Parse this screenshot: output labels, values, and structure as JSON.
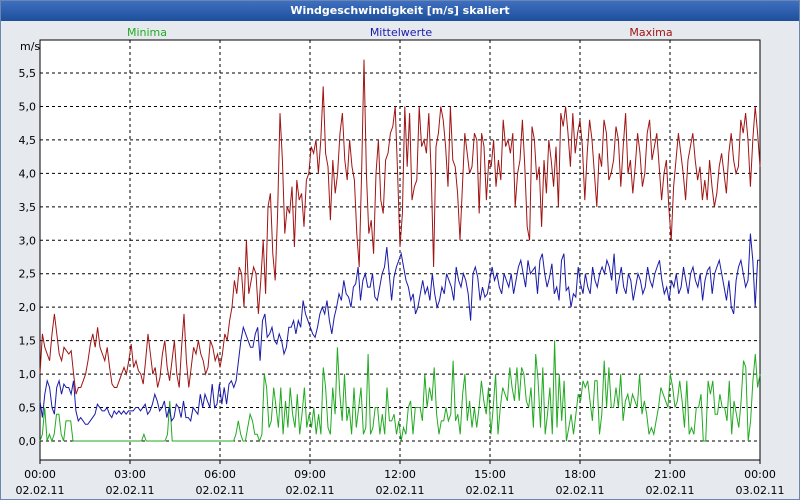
{
  "window": {
    "title": "Windgeschwindigkeit [m/s] skaliert"
  },
  "chart_data": {
    "type": "line",
    "title": "Windgeschwindigkeit [m/s] skaliert",
    "ylabel": "m/s",
    "ylim": [
      0,
      6
    ],
    "yticks": [
      "0,0",
      "0,5",
      "1,0",
      "1,5",
      "2,0",
      "2,5",
      "3,0",
      "3,5",
      "4,0",
      "4,5",
      "5,0",
      "5,5"
    ],
    "xlim": [
      "02.02.11 00:00",
      "03.02.11 00:00"
    ],
    "xticks": [
      {
        "time": "00:00",
        "date": "02.02.11"
      },
      {
        "time": "03:00",
        "date": "02.02.11"
      },
      {
        "time": "06:00",
        "date": "02.02.11"
      },
      {
        "time": "09:00",
        "date": "02.02.11"
      },
      {
        "time": "12:00",
        "date": "02.02.11"
      },
      {
        "time": "15:00",
        "date": "02.02.11"
      },
      {
        "time": "18:00",
        "date": "02.02.11"
      },
      {
        "time": "21:00",
        "date": "02.02.11"
      },
      {
        "time": "00:00",
        "date": "03.02.11"
      }
    ],
    "grid": true,
    "legend_placement": "top",
    "sample_interval_minutes": 10,
    "series": [
      {
        "name": "Minima",
        "color": "#22aa22",
        "values": [
          0,
          0.1,
          0.5,
          0,
          0.1,
          0,
          0.1,
          0.4,
          0.4,
          0.1,
          0,
          0.3,
          0.3,
          0.3,
          0,
          0,
          0,
          0,
          0,
          0,
          0,
          0,
          0,
          0,
          0,
          0,
          0,
          0,
          0,
          0,
          0,
          0,
          0,
          0,
          0,
          0,
          0,
          0,
          0,
          0,
          0,
          0,
          0,
          0,
          0.1,
          0,
          0,
          0,
          0,
          0,
          0,
          0,
          0,
          0,
          0.1,
          0.6,
          0,
          0,
          0,
          0,
          0,
          0,
          0,
          0,
          0,
          0,
          0,
          0,
          0,
          0,
          0,
          0,
          0,
          0,
          0,
          0,
          0,
          0,
          0,
          0,
          0,
          0,
          0,
          0.1,
          0.3,
          0.1,
          0,
          0,
          0.2,
          0.4,
          0.3,
          0.1,
          0.1,
          0,
          0.1,
          1,
          0.8,
          0.2,
          0.3,
          0.8,
          0.5,
          0.2,
          0.8,
          0.1,
          0.6,
          0.2,
          0.8,
          0.4,
          0.2,
          0.7,
          0.1,
          0.4,
          0.8,
          0.2,
          0.4,
          0.2,
          0.5,
          0.1,
          0.4,
          0.1,
          1.1,
          0.8,
          0.2,
          0.1,
          0.8,
          0.4,
          1.4,
          0.7,
          0.3,
          1,
          0.3,
          0.5,
          0.1,
          0.8,
          0.2,
          0.5,
          0.8,
          0.1,
          0.2,
          1.3,
          0.1,
          0.2,
          0.5,
          0.5,
          0.1,
          0.4,
          0.1,
          0.8,
          0.3,
          0.3,
          0.4,
          0.1,
          0.3,
          0,
          0.2,
          0.1,
          0.5,
          0.6,
          0.1,
          0.5,
          0.5,
          0.5,
          0.3,
          1,
          0.5,
          0.8,
          0.6,
          1.1,
          0.4,
          0.1,
          0.3,
          0.3,
          0.5,
          0.3,
          0.4,
          1.2,
          0.3,
          0.4,
          0.1,
          0.7,
          1,
          0.3,
          0.6,
          0.2,
          0.5,
          0.2,
          0.5,
          0.9,
          0.6,
          0.4,
          0.8,
          0.1,
          0.5,
          1,
          0.1,
          0.5,
          0.8,
          0.7,
          0.6,
          1.1,
          0.8,
          0.6,
          1.1,
          0.6,
          1.1,
          1,
          0.6,
          0.5,
          0.8,
          0.2,
          1.3,
          0.9,
          0.2,
          1.1,
          0.1,
          0.4,
          0.8,
          0.1,
          1.5,
          0.2,
          1,
          0.3,
          0.9,
          0,
          0.2,
          0.4,
          0.1,
          0.4,
          0.7,
          0.6,
          0.9,
          0.8,
          0.9,
          0.6,
          0.3,
          0.9,
          0.9,
          0.1,
          0.4,
          1.2,
          0.5,
          1.1,
          0.5,
          0.5,
          0.8,
          0.5,
          1,
          0.3,
          0.6,
          0.7,
          0.5,
          0.7,
          0.6,
          0.5,
          1,
          0.4,
          0.6,
          0.4,
          0.1,
          0.2,
          0.1,
          0.3,
          0.5,
          0.8,
          0.7,
          0.6,
          0.5,
          1,
          0.8,
          0.5,
          0.6,
          0.9,
          0.6,
          0.2,
          0.9,
          0.1,
          0.2,
          0.1,
          0.5,
          0.5,
          0.7,
          0,
          0,
          0.9,
          0.7,
          0.9,
          0.4,
          0.4,
          0.7,
          0.5,
          0.5,
          0.3,
          0.9,
          0.1,
          0.6,
          0.4,
          0.2,
          0.6,
          1.2,
          1.1,
          0,
          0.3,
          0.9,
          1.3,
          0.8,
          1
        ]
      },
      {
        "name": "Mittelwerte",
        "color": "#1a1aaa",
        "values": [
          0.6,
          0.35,
          0.7,
          0.9,
          0.8,
          0.5,
          0.4,
          0.8,
          0.9,
          0.7,
          0.85,
          0.8,
          0.8,
          0.7,
          0.9,
          0.45,
          0.3,
          0.35,
          0.3,
          0.25,
          0.25,
          0.3,
          0.35,
          0.4,
          0.55,
          0.5,
          0.45,
          0.45,
          0.5,
          0.4,
          0.35,
          0.45,
          0.4,
          0.45,
          0.4,
          0.45,
          0.4,
          0.45,
          0.45,
          0.45,
          0.5,
          0.5,
          0.45,
          0.5,
          0.55,
          0.4,
          0.45,
          0.55,
          0.7,
          0.6,
          0.45,
          0.5,
          0.6,
          0.35,
          0.5,
          0.3,
          0.35,
          0.55,
          0.5,
          0.35,
          0.6,
          0.35,
          0.35,
          0.3,
          0.5,
          0.45,
          0.4,
          0.7,
          0.5,
          0.7,
          0.6,
          0.5,
          0.85,
          0.5,
          0.55,
          0.85,
          0.55,
          0.8,
          0.55,
          0.85,
          0.9,
          0.8,
          0.9,
          1.2,
          1.5,
          1.7,
          1.6,
          1.5,
          1.4,
          1.4,
          1.6,
          1.7,
          1.2,
          1.8,
          1.9,
          1.55,
          1.6,
          1.7,
          1.5,
          1.45,
          1.6,
          1.5,
          1.3,
          1.4,
          1.7,
          1.7,
          1.8,
          1.6,
          1.8,
          1.7,
          2.1,
          1.9,
          1.8,
          1.7,
          1.6,
          1.55,
          1.7,
          1.9,
          2,
          1.9,
          2.1,
          1.8,
          1.6,
          1.85,
          2,
          2.2,
          2.1,
          2.4,
          2.2,
          2.15,
          2,
          2.3,
          2.35,
          2.6,
          2.1,
          2.4,
          2.5,
          2.3,
          2.3,
          2.5,
          2.15,
          2.1,
          2.3,
          2.5,
          2.6,
          2.9,
          2.5,
          2.1,
          2.45,
          2.6,
          2.7,
          2.8,
          2.6,
          2.4,
          2.3,
          2.1,
          2.2,
          1.9,
          2.0,
          2.2,
          2.4,
          2.2,
          2.3,
          2.1,
          2.5,
          2.2,
          2,
          2.1,
          2.3,
          2.2,
          2.5,
          2.4,
          2.3,
          2.1,
          2.6,
          2.4,
          2.3,
          2.5,
          2.4,
          2.2,
          1.8,
          2.5,
          2.6,
          2.45,
          2.1,
          2.3,
          2.15,
          2.2,
          2.4,
          2.6,
          2.4,
          2.5,
          2.3,
          2.2,
          2.5,
          2.4,
          2.3,
          2.5,
          2.2,
          2.4,
          2.6,
          2.7,
          2.5,
          2.3,
          2.7,
          2.5,
          2.55,
          2.6,
          2.2,
          2.7,
          2.8,
          2.5,
          2.3,
          2.45,
          2.65,
          2.2,
          2.3,
          2.1,
          2.7,
          2.8,
          2.25,
          2.3,
          2.0,
          2.2,
          2.15,
          2.6,
          2.35,
          2.2,
          2.5,
          2.3,
          2.2,
          2.6,
          2.4,
          2.3,
          2.5,
          2.6,
          2.5,
          2.7,
          2.6,
          2.4,
          2.8,
          2.2,
          2.4,
          2.6,
          2.3,
          2.2,
          2.5,
          2.4,
          2.1,
          2.3,
          2.5,
          2.4,
          2.2,
          2.3,
          2.6,
          2.4,
          2.3,
          2.5,
          2.6,
          2.7,
          2.4,
          2.2,
          2.3,
          2.1,
          2.4,
          2.3,
          2.5,
          2.2,
          2.3,
          2.6,
          2.4,
          2.2,
          2.5,
          2.6,
          2.4,
          2.3,
          2.5,
          2.1,
          2.4,
          2.55,
          2.6,
          2.2,
          2.5,
          2.6,
          2.7,
          2.5,
          2.3,
          2.1,
          2.4,
          2.0,
          1.9,
          2.4,
          2.6,
          2.7,
          2.5,
          2.3,
          2.4,
          3.1,
          2.7,
          2.0,
          2.7,
          2.7
        ]
      },
      {
        "name": "Maxima",
        "color": "#a01414",
        "values": [
          1.0,
          1.6,
          1.4,
          1.3,
          1.2,
          1.6,
          1.9,
          1.6,
          1.3,
          1.2,
          1.4,
          1.35,
          1.3,
          1.35,
          1.0,
          0.7,
          0.8,
          0.8,
          0.9,
          1.0,
          1.2,
          1.45,
          1.6,
          1.4,
          1.7,
          1.4,
          1.3,
          1.2,
          1.4,
          1.1,
          0.85,
          0.8,
          0.8,
          0.9,
          1.0,
          1.1,
          1.0,
          1.2,
          1.45,
          1.1,
          1.2,
          1.05,
          1.0,
          0.85,
          1.2,
          1.6,
          1.3,
          1.0,
          1.1,
          0.8,
          0.95,
          1.3,
          1.5,
          1.1,
          0.9,
          1.2,
          1.5,
          1.0,
          0.8,
          1.4,
          1.9,
          1.2,
          0.8,
          1.1,
          1.4,
          1.3,
          1.5,
          1.3,
          1.2,
          1.0,
          1.1,
          1.5,
          1.4,
          1.2,
          1.3,
          1.1,
          1.3,
          1.6,
          1.5,
          1.8,
          2.0,
          2.4,
          2.2,
          2.6,
          2.5,
          2.0,
          3.0,
          2.2,
          2.4,
          2.6,
          2.5,
          1.9,
          2.4,
          3.0,
          2.2,
          3.5,
          3.7,
          2.8,
          2.4,
          3.4,
          4.9,
          4.2,
          3.1,
          3.5,
          3.4,
          3.8,
          2.9,
          3.9,
          3.6,
          3.7,
          3.2,
          3.9,
          4.0,
          4.4,
          4.3,
          4.5,
          4.0,
          4.5,
          5.3,
          4.3,
          4.1,
          3.3,
          4.2,
          3.7,
          4.0,
          4.6,
          4.9,
          4.2,
          3.9,
          4.5,
          4.1,
          3.9,
          3.1,
          2.6,
          4.0,
          5.7,
          4.0,
          3.1,
          3.3,
          2.8,
          4.0,
          4.5,
          3.6,
          3.4,
          4.2,
          4.3,
          4.6,
          4.7,
          5.0,
          4.0,
          2.9,
          3.4,
          5.0,
          4.1,
          4.9,
          3.6,
          3.8,
          3.9,
          5.0,
          4.4,
          4.5,
          4.3,
          4.9,
          4.0,
          2.6,
          4.4,
          4.6,
          5.0,
          4.8,
          4.4,
          3.8,
          5.0,
          4.2,
          4.1,
          3.7,
          3.0,
          3.8,
          4.6,
          4.3,
          4.0,
          4.1,
          4.6,
          4.5,
          3.4,
          4.6,
          4.4,
          3.6,
          4.2,
          4.1,
          4.5,
          3.8,
          4.2,
          3.9,
          4.8,
          4.4,
          4.5,
          4.3,
          4.6,
          3.5,
          4.0,
          4.2,
          4.8,
          4.1,
          3.2,
          3.0,
          4.7,
          4.5,
          3.9,
          4.1,
          3.2,
          4.2,
          3.7,
          4.5,
          4.2,
          3.8,
          4.4,
          3.5,
          4.9,
          4.7,
          5.0,
          4.6,
          4.1,
          4.9,
          4.3,
          4.6,
          4.8,
          4.4,
          3.6,
          4.3,
          4.8,
          4.5,
          4.0,
          3.5,
          4.3,
          4.1,
          4.8,
          4.6,
          3.9,
          4.0,
          4.2,
          4.7,
          4.5,
          3.8,
          4.4,
          4.9,
          4.0,
          4.2,
          3.7,
          4.1,
          4.6,
          4.3,
          3.8,
          4.0,
          4.6,
          4.8,
          4.2,
          4.4,
          4.6,
          4.1,
          3.6,
          4.0,
          4.2,
          3.5,
          3.0,
          3.8,
          4.2,
          4.6,
          4.3,
          4.0,
          3.6,
          4.2,
          4.4,
          4.6,
          4.2,
          3.9,
          4.1,
          3.6,
          3.9,
          3.6,
          4.2,
          3.8,
          3.5,
          3.7,
          4.1,
          4.3,
          4.0,
          3.7,
          4.3,
          4.6,
          4.2,
          4.0,
          4.1,
          4.8,
          4.6,
          4.9,
          4.5,
          3.8,
          4.5,
          5.0,
          4.6,
          4.1
        ]
      }
    ]
  }
}
